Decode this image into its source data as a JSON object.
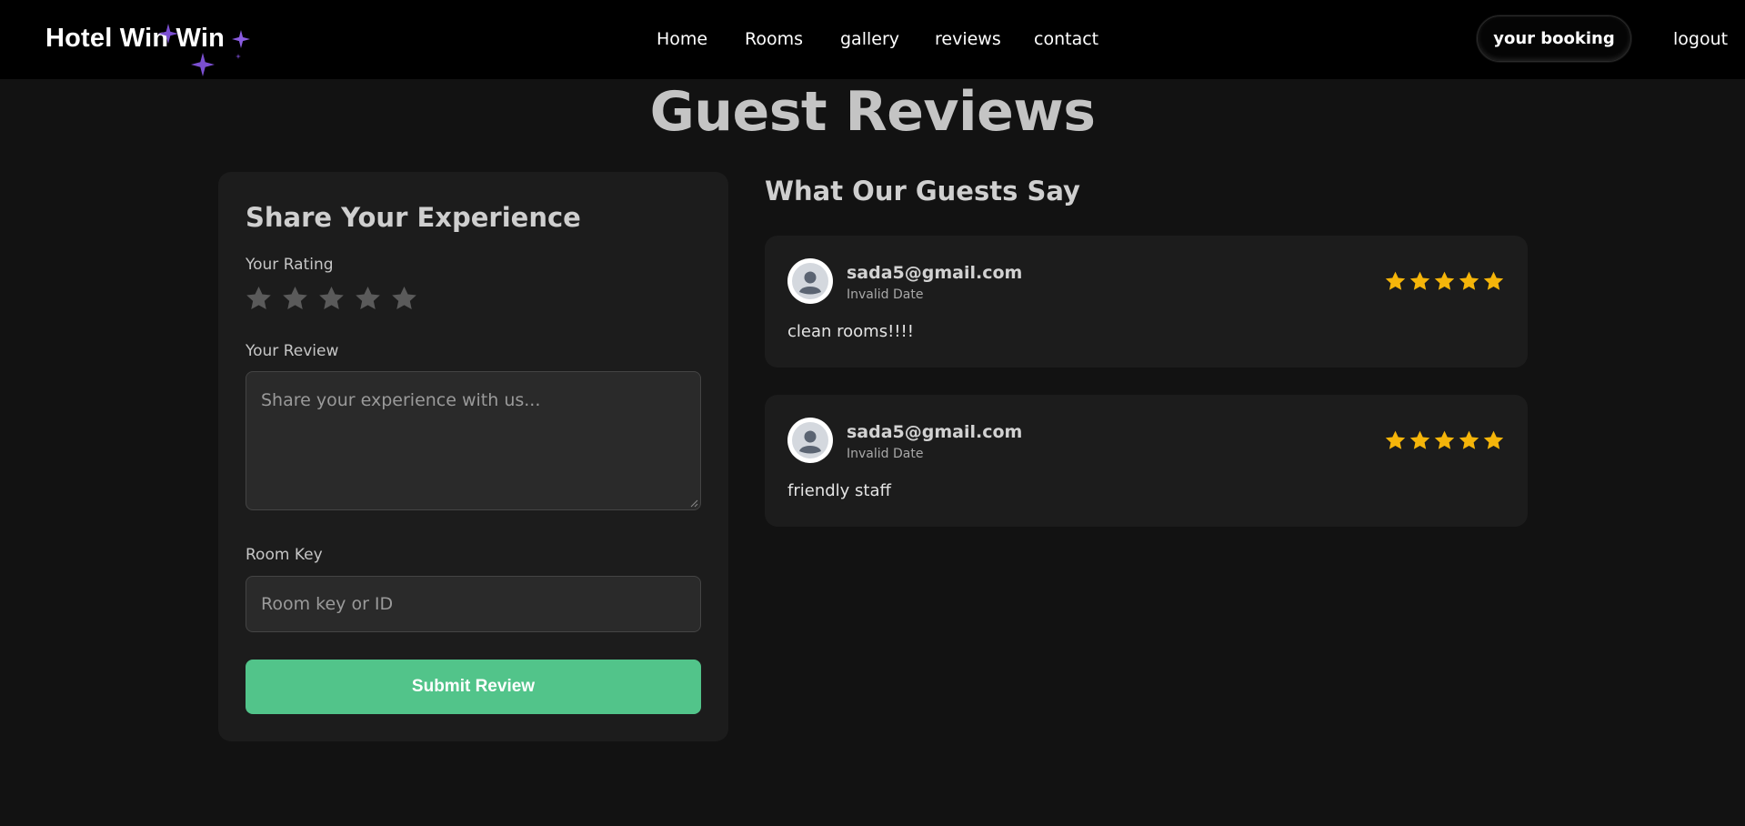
{
  "navbar": {
    "logo": "Hotel Win Win",
    "links": [
      "Home",
      "Rooms",
      "gallery",
      "reviews",
      "contact"
    ],
    "booking_button": "your booking",
    "logout": "logout"
  },
  "page": {
    "title": "Guest Reviews"
  },
  "form": {
    "title": "Share Your Experience",
    "rating_label": "Your Rating",
    "rating_value": 0,
    "rating_max": 5,
    "review_label": "Your Review",
    "review_placeholder": "Share your experience with us...",
    "room_key_label": "Room Key",
    "room_key_placeholder": "Room key or ID",
    "submit_label": "Submit Review"
  },
  "reviews": {
    "title": "What Our Guests Say",
    "items": [
      {
        "author": "sada5@gmail.com",
        "date": "Invalid Date",
        "rating": 5,
        "text": "clean rooms!!!!"
      },
      {
        "author": "sada5@gmail.com",
        "date": "Invalid Date",
        "rating": 5,
        "text": "friendly staff"
      }
    ]
  },
  "colors": {
    "accent_green": "#52c48a",
    "star_filled": "#f5b50a",
    "star_empty": "#5a5a5a",
    "sparkle": "#7b4fd1"
  },
  "icons": [
    "user-avatar-icon",
    "star-icon",
    "sparkle-icon",
    "resize-grip-icon"
  ]
}
